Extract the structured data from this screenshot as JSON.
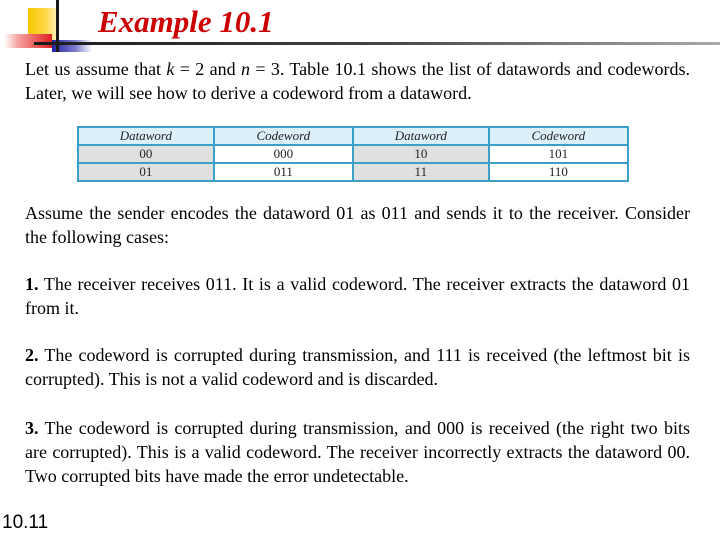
{
  "slide": {
    "title": "Example 10.1",
    "number": "10.11"
  },
  "intro": {
    "line1_pre": "Let us assume that ",
    "k_var": "k",
    "k_eq": " = 2 and ",
    "n_var": "n",
    "rest": " = 3. Table 10.1 shows the list of datawords and codewords. Later, we will see how to derive a codeword from a dataword."
  },
  "table": {
    "headers": [
      "Dataword",
      "Codeword",
      "Dataword",
      "Codeword"
    ],
    "rows": [
      [
        "00",
        "000",
        "10",
        "101"
      ],
      [
        "01",
        "011",
        "11",
        "110"
      ]
    ]
  },
  "assume": "Assume the sender encodes the dataword 01 as 011 and sends it to the receiver. Consider the following cases:",
  "cases": [
    {
      "num": "1.",
      "text": " The receiver receives 011. It is a valid codeword. The receiver extracts the dataword 01 from it."
    },
    {
      "num": "2.",
      "text": " The codeword is corrupted during transmission, and 111 is received (the leftmost bit is corrupted). This is not a valid codeword and is discarded."
    },
    {
      "num": "3.",
      "text": " The codeword is corrupted during transmission, and 000 is received (the right two bits are corrupted). This is a valid codeword. The receiver incorrectly extracts the dataword 00. Two corrupted bits have made the error undetectable."
    }
  ]
}
